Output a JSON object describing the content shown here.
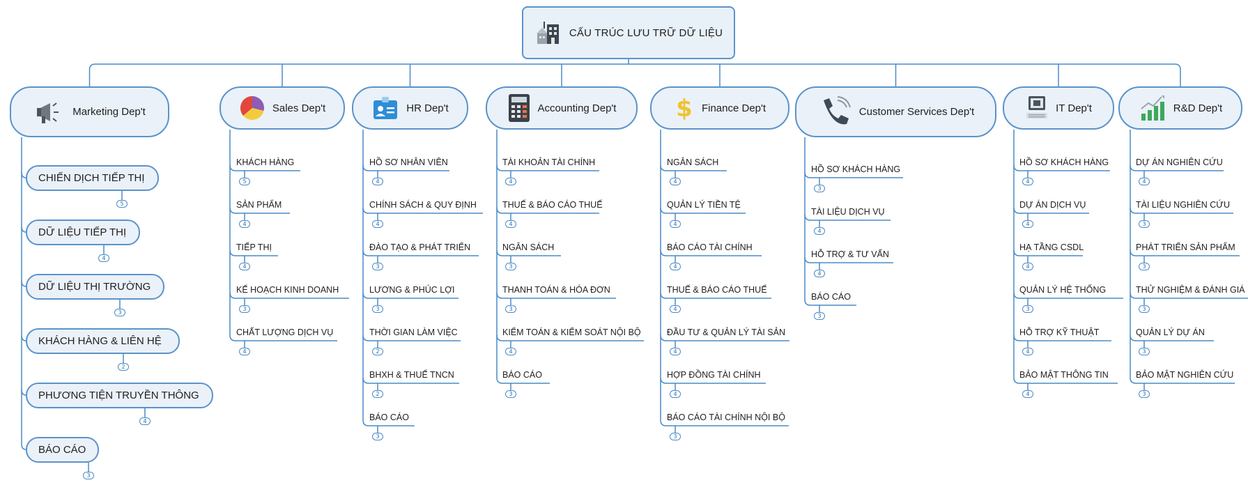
{
  "root": {
    "title": "CẤU TRÚC LƯU TRỮ DỮ LIỆU",
    "icon": "building-icon"
  },
  "colors": {
    "line": "#4a8ac7",
    "node_fill": "#eaf1f9",
    "node_border": "#5b93c9"
  },
  "departments": [
    {
      "label": "Marketing Dep't",
      "icon": "megaphone-icon",
      "items": [
        {
          "text": "CHIẾN DỊCH TIẾP THỊ",
          "count": "5"
        },
        {
          "text": "DỮ LIỆU TIẾP THỊ",
          "count": "4"
        },
        {
          "text": "DỮ LIỆU THỊ TRƯỜNG",
          "count": "3"
        },
        {
          "text": "KHÁCH HÀNG & LIÊN HỆ",
          "count": "2"
        },
        {
          "text": "PHƯƠNG TIỆN TRUYỀN THÔNG",
          "count": "4"
        },
        {
          "text": "BÁO CÁO",
          "count": "3"
        }
      ]
    },
    {
      "label": "Sales Dep't",
      "icon": "pie-chart-icon",
      "items": [
        {
          "text": "KHÁCH HÀNG",
          "count": "5"
        },
        {
          "text": "SẢN PHẨM",
          "count": "4"
        },
        {
          "text": "TIẾP THỊ",
          "count": "4"
        },
        {
          "text": "KẾ HOẠCH KINH DOANH",
          "count": "3"
        },
        {
          "text": "CHẤT LƯỢNG DỊCH VỤ",
          "count": "4"
        }
      ]
    },
    {
      "label": "HR Dep't",
      "icon": "id-card-icon",
      "items": [
        {
          "text": "HỒ SƠ NHÂN VIÊN",
          "count": "4"
        },
        {
          "text": "CHÍNH SÁCH & QUY ĐỊNH",
          "count": "4"
        },
        {
          "text": "ĐÀO TẠO & PHÁT TRIỂN",
          "count": "3"
        },
        {
          "text": "LƯƠNG & PHÚC LỢI",
          "count": "3"
        },
        {
          "text": "THỜI GIAN LÀM VIỆC",
          "count": "2"
        },
        {
          "text": "BHXH & THUẾ TNCN",
          "count": "2"
        },
        {
          "text": "BÁO CÁO",
          "count": "3"
        }
      ]
    },
    {
      "label": "Accounting Dep't",
      "icon": "calculator-icon",
      "items": [
        {
          "text": "TÀI KHOẢN TÀI CHÍNH",
          "count": "4"
        },
        {
          "text": "THUẾ & BÁO CÁO THUẾ",
          "count": "4"
        },
        {
          "text": "NGÂN SÁCH",
          "count": "3"
        },
        {
          "text": "THANH TOÁN & HÓA ĐƠN",
          "count": "3"
        },
        {
          "text": "KIỂM TOÁN & KIỂM SOÁT NỘI BỘ",
          "count": "4"
        },
        {
          "text": "BÁO CÁO",
          "count": "3"
        }
      ]
    },
    {
      "label": "Finance Dep't",
      "icon": "dollar-icon",
      "items": [
        {
          "text": "NGÂN SÁCH",
          "count": "4"
        },
        {
          "text": "QUẢN LÝ TIỀN TỆ",
          "count": "4"
        },
        {
          "text": "BÁO CÁO TÀI CHÍNH",
          "count": "4"
        },
        {
          "text": "THUẾ & BÁO CÁO THUẾ",
          "count": "4"
        },
        {
          "text": "ĐẦU TƯ & QUẢN LÝ TÀI SẢN",
          "count": "4"
        },
        {
          "text": "HỢP ĐỒNG TÀI CHÍNH",
          "count": "4"
        },
        {
          "text": "BÁO CÁO TÀI CHÍNH NỘI BỘ",
          "count": "3"
        }
      ]
    },
    {
      "label": "Customer Services Dep't",
      "icon": "phone-icon",
      "items": [
        {
          "text": "HỒ SƠ KHÁCH HÀNG",
          "count": "3"
        },
        {
          "text": "TÀI LIỆU DỊCH VỤ",
          "count": "4"
        },
        {
          "text": "HỖ TRỢ & TƯ VẤN",
          "count": "4"
        },
        {
          "text": "BÁO CÁO",
          "count": "3"
        }
      ]
    },
    {
      "label": "IT Dep't",
      "icon": "computer-icon",
      "items": [
        {
          "text": "HỒ SƠ KHÁCH HÀNG",
          "count": "4"
        },
        {
          "text": "DỰ ÁN DỊCH VỤ",
          "count": "4"
        },
        {
          "text": "HẠ TẦNG CSDL",
          "count": "4"
        },
        {
          "text": "QUẢN LÝ HỆ THỐNG",
          "count": "3"
        },
        {
          "text": "HỖ TRỢ KỸ THUẬT",
          "count": "4"
        },
        {
          "text": "BẢO MẬT THÔNG TIN",
          "count": "4"
        }
      ]
    },
    {
      "label": "R&D Dep't",
      "icon": "growth-chart-icon",
      "items": [
        {
          "text": "DỰ ÁN NGHIÊN CỨU",
          "count": "4"
        },
        {
          "text": "TÀI LIỆU NGHIÊN CỨU",
          "count": "3"
        },
        {
          "text": "PHÁT TRIỂN SẢN PHẨM",
          "count": "3"
        },
        {
          "text": "THỬ NGHIỆM & ĐÁNH GIÁ",
          "count": "3"
        },
        {
          "text": "QUẢN LÝ DỰ ÁN",
          "count": "3"
        },
        {
          "text": "BẢO MẬT NGHIÊN CỨU",
          "count": "3"
        }
      ]
    }
  ]
}
